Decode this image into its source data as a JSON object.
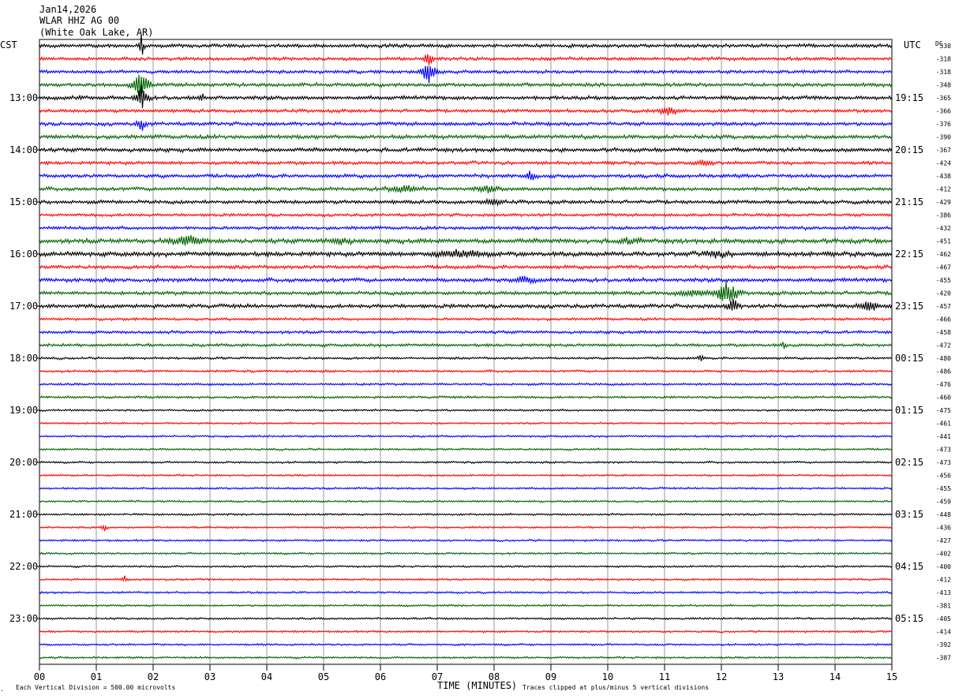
{
  "header": {
    "date": "Jan14,2026",
    "station": "WLAR HHZ AG 00",
    "location": "(White Oak Lake, AR)"
  },
  "left_zone": "CST",
  "right_zone": "UTC",
  "dc_header": "DC",
  "footer": {
    "scale_note": "Each Vertical Division =  500.00 microvolts",
    "clip_note": "Traces clipped at plus/minus 5 vertical divisions",
    "x_axis_title": "TIME (MINUTES)"
  },
  "chart_data": {
    "type": "line",
    "subtype": "helicorder",
    "x_unit": "minutes",
    "xlim": [
      0,
      15
    ],
    "x_ticks": [
      "00",
      "01",
      "02",
      "03",
      "04",
      "05",
      "06",
      "07",
      "08",
      "09",
      "10",
      "11",
      "12",
      "13",
      "14",
      "15"
    ],
    "line_minutes": 15,
    "colors": [
      "#000000",
      "#ff0000",
      "#0000ff",
      "#006400"
    ],
    "left_hour_labels": [
      "13:00",
      "14:00",
      "15:00",
      "16:00",
      "17:00",
      "18:00",
      "19:00",
      "20:00",
      "21:00",
      "22:00",
      "23:00"
    ],
    "right_hour_labels": [
      "19:15",
      "20:15",
      "21:15",
      "22:15",
      "23:15",
      "00:15",
      "01:15",
      "02:15",
      "03:15",
      "04:15",
      "05:15"
    ],
    "dc_offsets": [
      "330",
      "-318",
      "-318",
      "-348",
      "-365",
      "-366",
      "-376",
      "-390",
      "-367",
      "-424",
      "-438",
      "-412",
      "-429",
      "-386",
      "-432",
      "-451",
      "-462",
      "-467",
      "-455",
      "-420",
      "-457",
      "-466",
      "-458",
      "-472",
      "-480",
      "-486",
      "-476",
      "-460",
      "-475",
      "-461",
      "-441",
      "-473",
      "-473",
      "-456",
      "-455",
      "-459",
      "-448",
      "-436",
      "-427",
      "-402",
      "-400",
      "-412",
      "-413",
      "-381",
      "-405",
      "-414",
      "-392",
      "-387"
    ],
    "noise_level": [
      0.55,
      0.5,
      0.5,
      0.55,
      0.6,
      0.5,
      0.55,
      0.6,
      0.6,
      0.5,
      0.55,
      0.55,
      0.55,
      0.45,
      0.5,
      0.7,
      0.7,
      0.55,
      0.6,
      0.55,
      0.6,
      0.4,
      0.45,
      0.45,
      0.35,
      0.35,
      0.35,
      0.35,
      0.3,
      0.3,
      0.3,
      0.3,
      0.3,
      0.3,
      0.3,
      0.3,
      0.3,
      0.3,
      0.3,
      0.3,
      0.3,
      0.3,
      0.3,
      0.3,
      0.3,
      0.3,
      0.3,
      0.3
    ],
    "events": [
      {
        "line": 0,
        "minute": 1.8,
        "amplitude": 5,
        "duration": 0.08
      },
      {
        "line": 1,
        "minute": 6.85,
        "amplitude": 2.5,
        "duration": 0.15
      },
      {
        "line": 2,
        "minute": 6.85,
        "amplitude": 5,
        "duration": 0.25
      },
      {
        "line": 3,
        "minute": 1.78,
        "amplitude": 5,
        "duration": 0.3
      },
      {
        "line": 4,
        "minute": 1.8,
        "amplitude": 5,
        "duration": 0.2
      },
      {
        "line": 4,
        "minute": 2.85,
        "amplitude": 1.5,
        "duration": 0.1
      },
      {
        "line": 5,
        "minute": 11.1,
        "amplitude": 1.6,
        "duration": 0.35
      },
      {
        "line": 6,
        "minute": 1.8,
        "amplitude": 2.5,
        "duration": 0.15
      },
      {
        "line": 9,
        "minute": 11.7,
        "amplitude": 1.2,
        "duration": 0.3
      },
      {
        "line": 10,
        "minute": 8.65,
        "amplitude": 1.8,
        "duration": 0.2
      },
      {
        "line": 11,
        "minute": 6.4,
        "amplitude": 1.2,
        "duration": 0.6
      },
      {
        "line": 11,
        "minute": 7.9,
        "amplitude": 1.1,
        "duration": 0.4
      },
      {
        "line": 12,
        "minute": 8.0,
        "amplitude": 1.0,
        "duration": 0.3
      },
      {
        "line": 15,
        "minute": 2.6,
        "amplitude": 1.8,
        "duration": 0.6
      },
      {
        "line": 15,
        "minute": 5.3,
        "amplitude": 1.1,
        "duration": 0.4
      },
      {
        "line": 15,
        "minute": 10.4,
        "amplitude": 1.0,
        "duration": 0.4
      },
      {
        "line": 16,
        "minute": 7.4,
        "amplitude": 1.1,
        "duration": 1.0
      },
      {
        "line": 16,
        "minute": 11.9,
        "amplitude": 1.3,
        "duration": 0.4
      },
      {
        "line": 18,
        "minute": 8.55,
        "amplitude": 1.3,
        "duration": 0.4
      },
      {
        "line": 19,
        "minute": 12.1,
        "amplitude": 5,
        "duration": 0.35
      },
      {
        "line": 19,
        "minute": 11.5,
        "amplitude": 1.0,
        "duration": 0.6
      },
      {
        "line": 20,
        "minute": 12.2,
        "amplitude": 3,
        "duration": 0.2
      },
      {
        "line": 20,
        "minute": 14.6,
        "amplitude": 2.2,
        "duration": 0.3
      },
      {
        "line": 23,
        "minute": 13.1,
        "amplitude": 1.2,
        "duration": 0.08
      },
      {
        "line": 24,
        "minute": 11.65,
        "amplitude": 1.3,
        "duration": 0.1
      },
      {
        "line": 37,
        "minute": 1.15,
        "amplitude": 1.2,
        "duration": 0.1
      },
      {
        "line": 41,
        "minute": 1.5,
        "amplitude": 1.4,
        "duration": 0.08
      }
    ]
  }
}
